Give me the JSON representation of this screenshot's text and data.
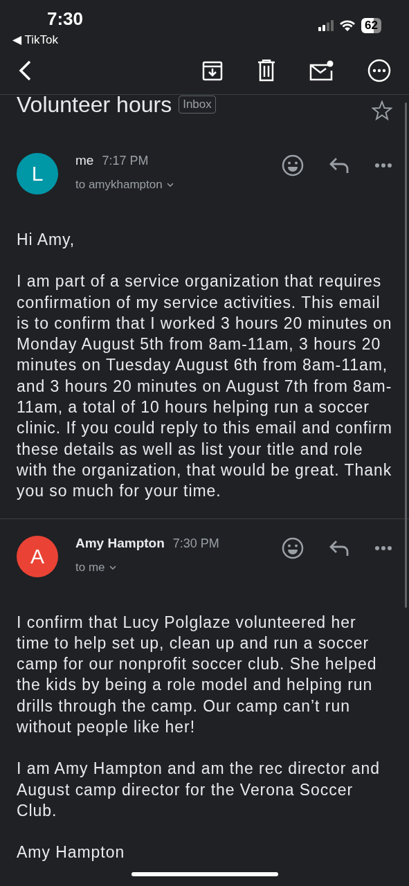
{
  "status_bar": {
    "time": "7:30",
    "back_app": "◀ TikTok",
    "battery": "62"
  },
  "subject": "Volunteer hours",
  "label": "Inbox",
  "starred": false,
  "messages": [
    {
      "avatar": "L",
      "color": "#0097a7",
      "sender": "me",
      "unread": false,
      "time": "7:17 PM",
      "recipient": "to amykhampton",
      "paragraphs": [
        "Hi Amy,",
        "I am part of a service organization that requires confirmation of my service activities. This email is to confirm that I worked 3 hours 20 minutes on Monday August 5th from 8am-11am, 3 hours 20 minutes on Tuesday August 6th from 8am-11am, and 3 hours 20 minutes on August 7th from 8am-11am, a total of 10 hours helping run a soccer clinic. If you could reply to this email and confirm these details as well as list your title and role with the organization, that would be great. Thank you so much for your time."
      ]
    },
    {
      "avatar": "A",
      "color": "#ea4335",
      "sender": "Amy Hampton",
      "unread": true,
      "time": "7:30 PM",
      "recipient": "to me",
      "paragraphs": [
        "I confirm that Lucy Polglaze volunteered her time to help set up, clean up and run a soccer camp for our nonprofit soccer club. She helped the kids by being a role model and helping run drills through the camp. Our camp can’t run without people like her!",
        "I am Amy Hampton and am the rec director and August camp director for the Verona Soccer Club.",
        "Amy Hampton"
      ]
    }
  ]
}
